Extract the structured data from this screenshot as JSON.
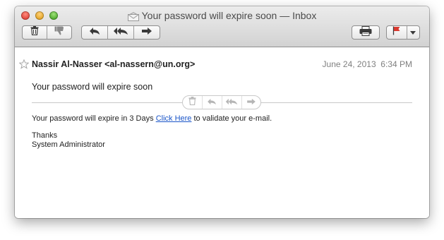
{
  "window": {
    "title": "Your password will expire soon — Inbox"
  },
  "toolbar": {
    "delete_icon": "trash-icon",
    "junk_icon": "thumbs-down-icon",
    "reply_icon": "reply-arrow-icon",
    "reply_all_icon": "reply-all-icon",
    "forward_icon": "forward-arrow-icon",
    "print_icon": "printer-icon",
    "flag_icon": "flag-icon",
    "flag_color": "#d9392f"
  },
  "message": {
    "from": "Nassir Al-Nasser <al-nassern@un.org>",
    "date": "June 24, 2013",
    "time": "6:34 PM",
    "subject": "Your password will expire soon",
    "body_prefix": "Your password will expire in 3 Days ",
    "link_text": "Click Here",
    "body_suffix": " to validate your e-mail.",
    "sign_line1": "Thanks",
    "sign_line2": "System Administrator"
  }
}
